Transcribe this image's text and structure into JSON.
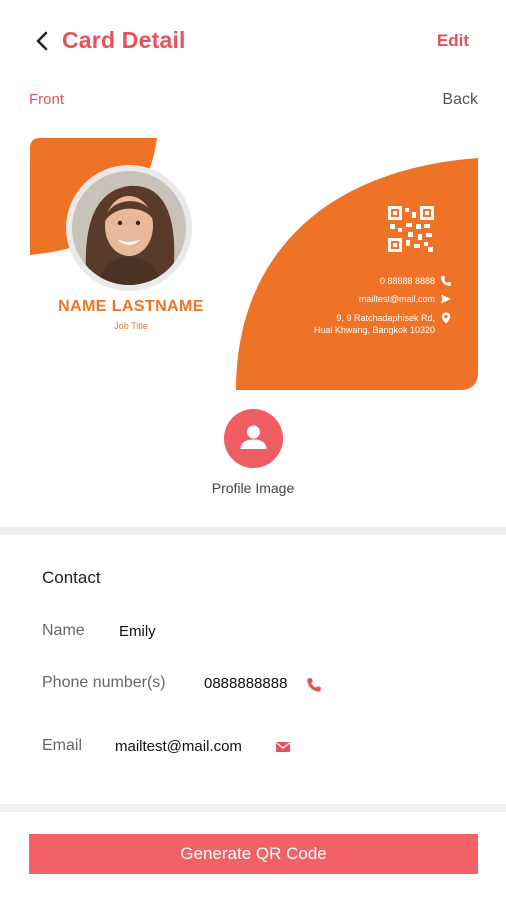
{
  "header": {
    "title": "Card Detail",
    "edit_label": "Edit"
  },
  "tabs": {
    "front": "Front",
    "back": "Back"
  },
  "card": {
    "name": "NAME LASTNAME",
    "job_title": "Job Title",
    "phone": "0 88888 8888",
    "email": "mailtest@mail.com",
    "address_line1": "9, 9 Ratchadaphisek Rd,",
    "address_line2": "Huai Khwang, Bangkok 10320"
  },
  "profile": {
    "label": "Profile Image"
  },
  "contact": {
    "title": "Contact",
    "name_label": "Name",
    "name_value": "Emily",
    "phone_label": "Phone number(s)",
    "phone_value": "0888888888",
    "email_label": "Email",
    "email_value": "mailtest@mail.com"
  },
  "actions": {
    "generate_label": "Generate QR Code"
  },
  "colors": {
    "accent": "#e8505b",
    "card_orange": "#ee7326",
    "button": "#f06265"
  }
}
